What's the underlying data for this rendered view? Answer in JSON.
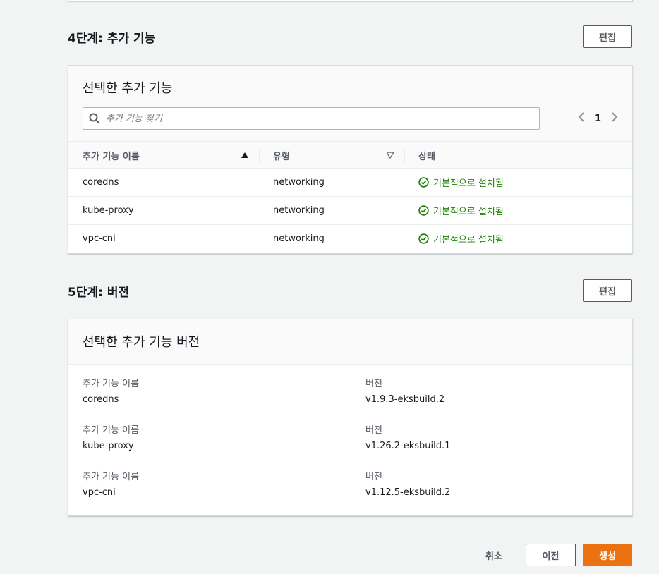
{
  "step4": {
    "title": "4단계: 추가 기능",
    "edit_label": "편집",
    "card_title": "선택한 추가 기능",
    "search_placeholder": "추가 기능 찾기",
    "page_number": "1",
    "columns": [
      "추가 기능 이름",
      "유형",
      "상태"
    ],
    "rows": [
      {
        "name": "coredns",
        "type": "networking",
        "status": "기본적으로 설치됨"
      },
      {
        "name": "kube-proxy",
        "type": "networking",
        "status": "기본적으로 설치됨"
      },
      {
        "name": "vpc-cni",
        "type": "networking",
        "status": "기본적으로 설치됨"
      }
    ]
  },
  "step5": {
    "title": "5단계: 버전",
    "edit_label": "편집",
    "card_title": "선택한 추가 기능 버전",
    "name_label": "추가 기능 이름",
    "version_label": "버전",
    "items": [
      {
        "name": "coredns",
        "version": "v1.9.3-eksbuild.2"
      },
      {
        "name": "kube-proxy",
        "version": "v1.26.2-eksbuild.1"
      },
      {
        "name": "vpc-cni",
        "version": "v1.12.5-eksbuild.2"
      }
    ]
  },
  "footer": {
    "cancel_label": "취소",
    "previous_label": "이전",
    "create_label": "생성"
  },
  "colors": {
    "success": "#1d8102",
    "primary": "#ec7211"
  }
}
